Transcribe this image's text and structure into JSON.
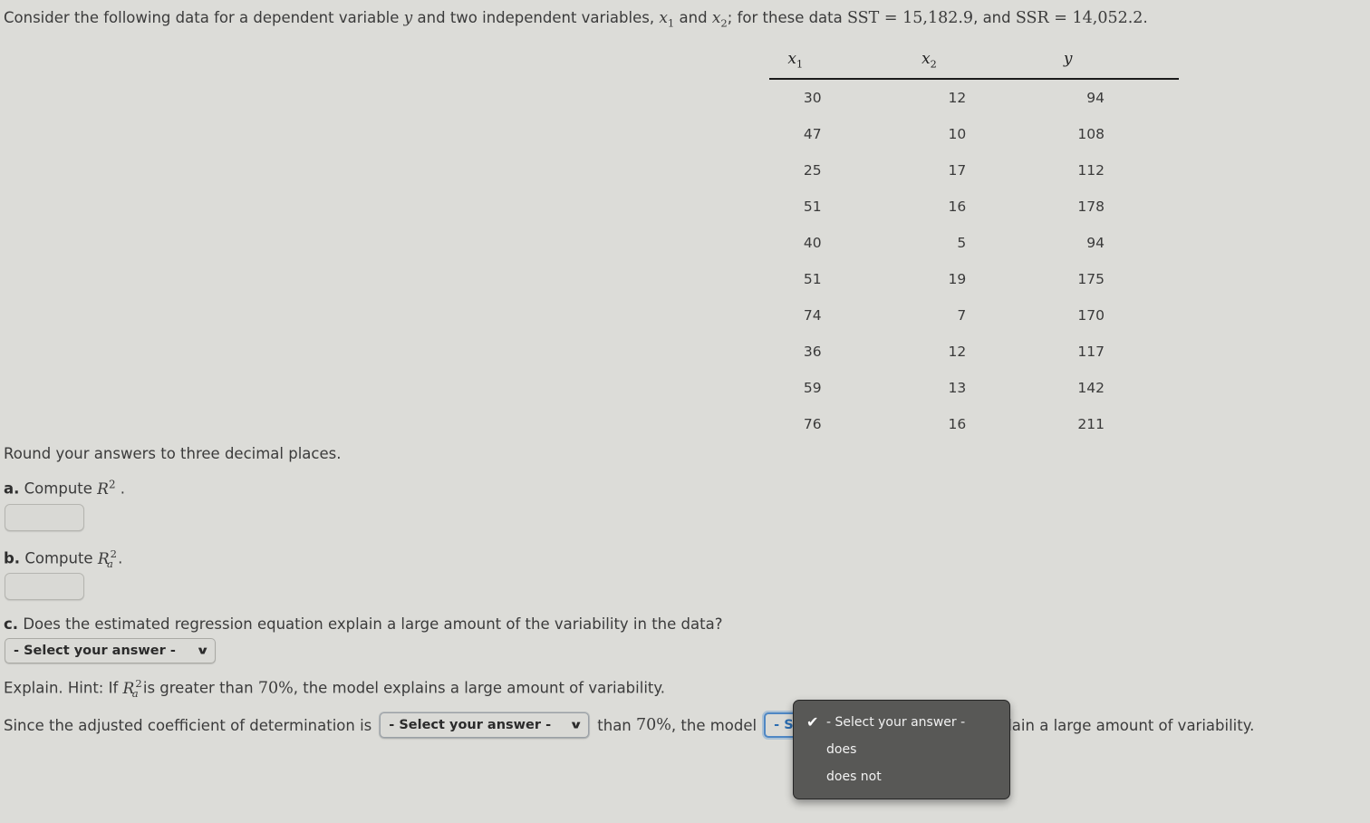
{
  "intro": {
    "part1": "Consider the following data for a dependent variable ",
    "var_y": "y",
    "part2": " and two independent variables, ",
    "var_x1": "x",
    "var_x1_sub": "1",
    "part3": " and ",
    "var_x2": "x",
    "var_x2_sub": "2",
    "part4": "; for these data ",
    "sst_label": "SST",
    "sst_eq": " = ",
    "sst_value": "15,182.9",
    "mid": ", and ",
    "ssr_label": "SSR",
    "ssr_eq": " = ",
    "ssr_value": "14,052.2",
    "period": "."
  },
  "table": {
    "headers": [
      {
        "sym": "x",
        "sub": "1"
      },
      {
        "sym": "x",
        "sub": "2"
      },
      {
        "sym": "y",
        "sub": ""
      }
    ],
    "rows": [
      {
        "x1": "30",
        "x2": "12",
        "y": "94"
      },
      {
        "x1": "47",
        "x2": "10",
        "y": "108"
      },
      {
        "x1": "25",
        "x2": "17",
        "y": "112"
      },
      {
        "x1": "51",
        "x2": "16",
        "y": "178"
      },
      {
        "x1": "40",
        "x2": "5",
        "y": "94"
      },
      {
        "x1": "51",
        "x2": "19",
        "y": "175"
      },
      {
        "x1": "74",
        "x2": "7",
        "y": "170"
      },
      {
        "x1": "36",
        "x2": "12",
        "y": "117"
      },
      {
        "x1": "59",
        "x2": "13",
        "y": "142"
      },
      {
        "x1": "76",
        "x2": "16",
        "y": "211"
      }
    ]
  },
  "instructions": {
    "rounding": "Round your answers to three decimal places."
  },
  "part_a": {
    "label": "a.",
    "text": "Compute",
    "symbol": "R",
    "exponent": "2",
    "period": ".",
    "input_value": "",
    "input_placeholder": ""
  },
  "part_b": {
    "label": "b.",
    "text": "Compute",
    "symbol": "R",
    "exponent": "2",
    "subscript": "a",
    "period": ".",
    "input_value": "",
    "input_placeholder": ""
  },
  "part_c": {
    "label": "c.",
    "question": "Does the estimated regression equation explain a large amount of the variability in the data?",
    "select_value": "- Select your answer -",
    "chevron": "∨"
  },
  "explain": {
    "pre": "Explain. Hint: If ",
    "symbol": "R",
    "exponent": "2",
    "subscript": "a",
    "mid": " is greater than ",
    "threshold": "70%",
    "post": ", the model explains a large amount of variability."
  },
  "since": {
    "pre": "Since the adjusted coefficient of determination is",
    "select1_value": "- Select your answer -",
    "mid1": "than",
    "threshold": "70%",
    "mid2": ", the model",
    "select2_value": "- Select your answer -",
    "post": "explain a large amount of variability.",
    "chevron": "∨"
  },
  "popup": {
    "items": [
      {
        "label": "- Select your answer -",
        "checked": true
      },
      {
        "label": "does",
        "checked": false
      },
      {
        "label": "does not",
        "checked": false
      }
    ],
    "check_glyph": "✔"
  },
  "colors": {
    "page_background": "#dcdcd8",
    "text": "#3b3b3b",
    "popup_background": "#585856",
    "popup_text": "#f2f2f2",
    "focus_ring": "#4f87c4",
    "table_rule": "#1a1a1a"
  }
}
